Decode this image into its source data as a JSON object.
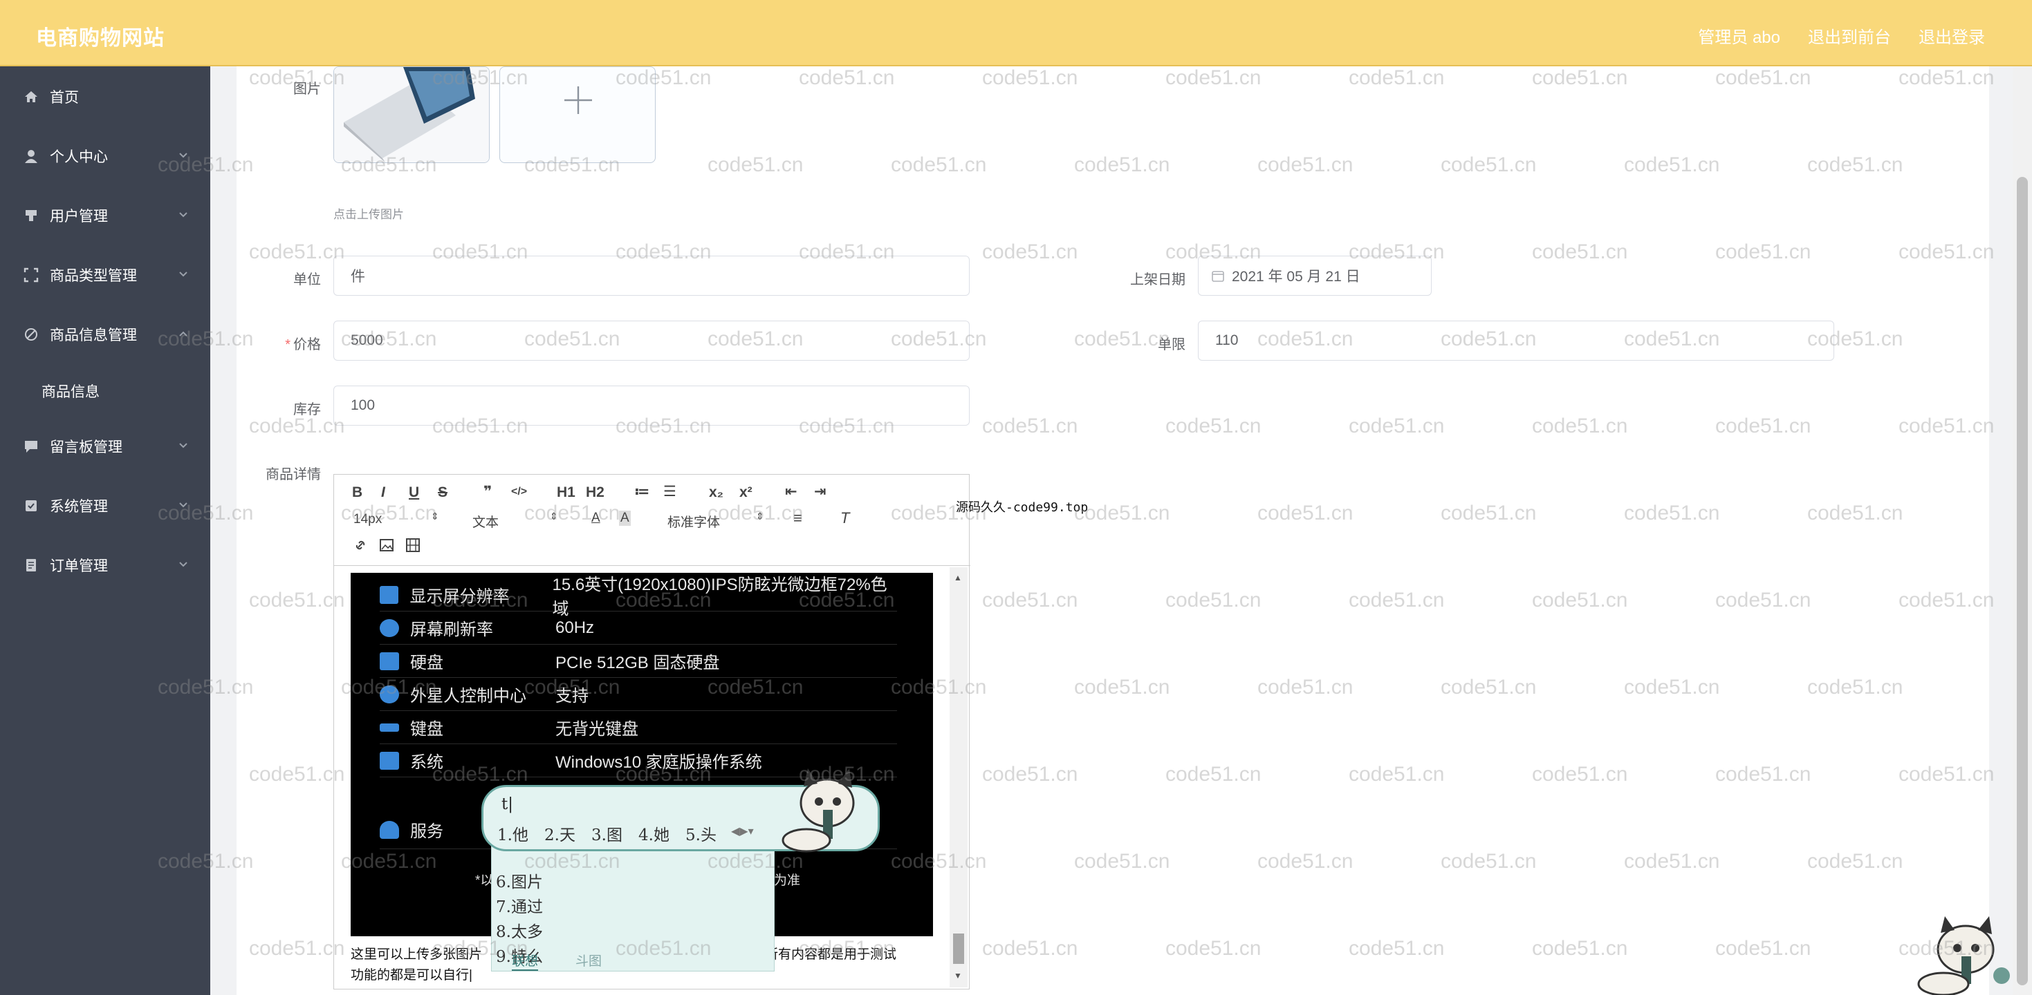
{
  "header": {
    "title": "电商购物网站",
    "nav": [
      "管理员 abo",
      "退出到前台",
      "退出登录"
    ]
  },
  "sidebar": {
    "items": [
      {
        "label": "首页",
        "icon": "home-icon"
      },
      {
        "label": "个人中心",
        "icon": "user-icon"
      },
      {
        "label": "用户管理",
        "icon": "users-icon"
      },
      {
        "label": "商品类型管理",
        "icon": "category-icon"
      },
      {
        "label": "商品信息管理",
        "icon": "product-icon"
      },
      {
        "label": "商品信息",
        "icon": ""
      },
      {
        "label": "留言板管理",
        "icon": "message-icon"
      },
      {
        "label": "系统管理",
        "icon": "system-icon"
      },
      {
        "label": "订单管理",
        "icon": "order-icon"
      }
    ]
  },
  "form": {
    "image_label": "图片",
    "upload_tip": "点击上传图片",
    "unit_label": "单位",
    "unit_value": "件",
    "date_label": "上架日期",
    "date_value": "2021 年 05 月 21 日",
    "price_label": "价格",
    "price_value": "5000",
    "limit_label": "单限",
    "limit_value": "110",
    "stock_label": "库存",
    "stock_value": "100",
    "detail_label": "商品详情"
  },
  "editor": {
    "toolbar_row1": [
      "B",
      "I",
      "U",
      "S",
      "❞",
      "</>",
      "H1",
      "H2",
      "≔",
      "☰",
      "x₂",
      "x²",
      "⇤",
      "⇥"
    ],
    "font_size": "14px",
    "header_select": "文本",
    "font_family": "标准字体",
    "specs": [
      {
        "key": "显示屏分辨率",
        "value": "15.6英寸(1920x1080)IPS防眩光微边框72%色域",
        "color": "#3a88d8"
      },
      {
        "key": "屏幕刷新率",
        "value": "60Hz",
        "color": "#3a88d8"
      },
      {
        "key": "硬盘",
        "value": "PCIe 512GB 固态硬盘",
        "color": "#3a88d8"
      },
      {
        "key": "外星人控制中心",
        "value": "支持",
        "color": "#3a88d8"
      },
      {
        "key": "键盘",
        "value": "无背光键盘",
        "color": "#3a88d8"
      },
      {
        "key": "系统",
        "value": "Windows10 家庭版操作系统",
        "color": "#3a88d8"
      },
      {
        "key": "服务",
        "value": "",
        "color": "#3a88d8"
      }
    ],
    "note_left": "*以",
    "note_right": "为准",
    "text_line1_left": "这里可以上传多张图片",
    "text_line1_right": "的所有内容都是用于测试",
    "text_line2": "功能的都是可以自行"
  },
  "ime": {
    "input": "t|",
    "candidates_row": [
      "1.他",
      "2.天",
      "3.图",
      "4.她",
      "5.头"
    ],
    "candidates_list": [
      "6.图片",
      "7.通过",
      "8.太多",
      "9.特么"
    ],
    "tabs": [
      "联想",
      "斗图"
    ]
  },
  "promo_text": "源码久久-code99.top",
  "watermark": "code51.cn"
}
